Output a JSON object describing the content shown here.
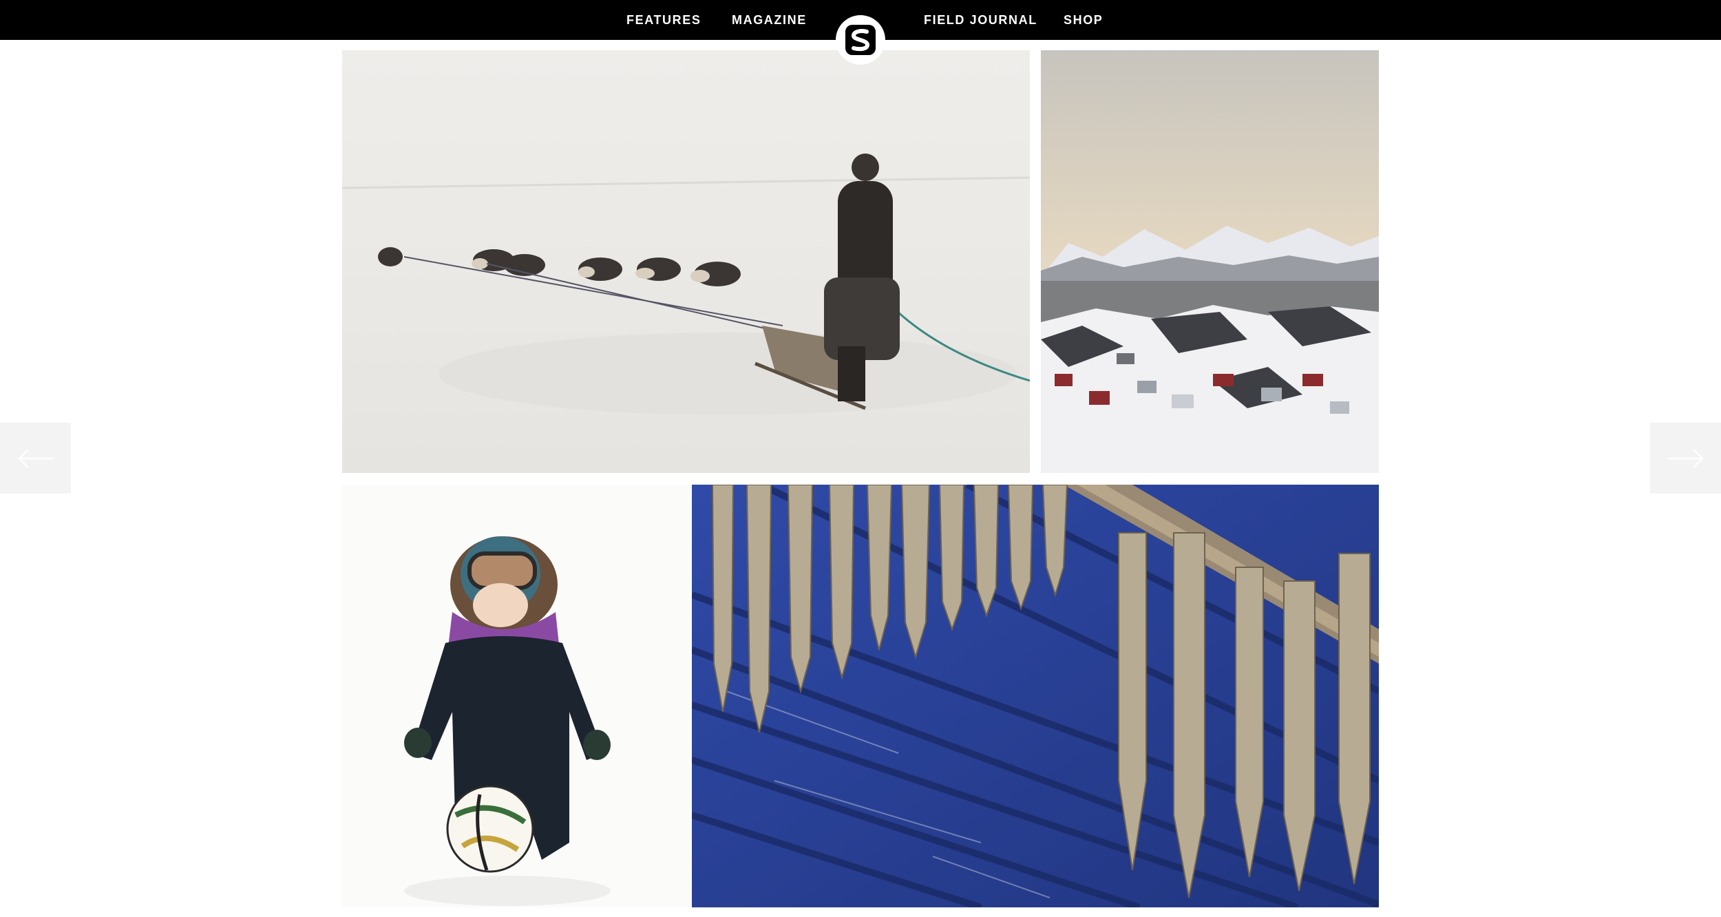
{
  "nav": {
    "links": [
      {
        "label": "FEATURES"
      },
      {
        "label": "MAGAZINE"
      },
      {
        "label": "FIELD JOURNAL"
      },
      {
        "label": "SHOP"
      }
    ],
    "logo_letter": "S"
  },
  "gallery": {
    "photos": [
      {
        "icon": "dog-sled-photo"
      },
      {
        "icon": "snowy-town-photo"
      },
      {
        "icon": "child-football-photo"
      },
      {
        "icon": "drying-fish-photo"
      }
    ],
    "prev_icon": "arrow-left-icon",
    "next_icon": "arrow-right-icon"
  },
  "colors": {
    "nav_bg": "#000000",
    "nav_text": "#ffffff",
    "arrow_bg": "#f3f3f3",
    "fish_wall_blue": "#2a3f9a"
  }
}
